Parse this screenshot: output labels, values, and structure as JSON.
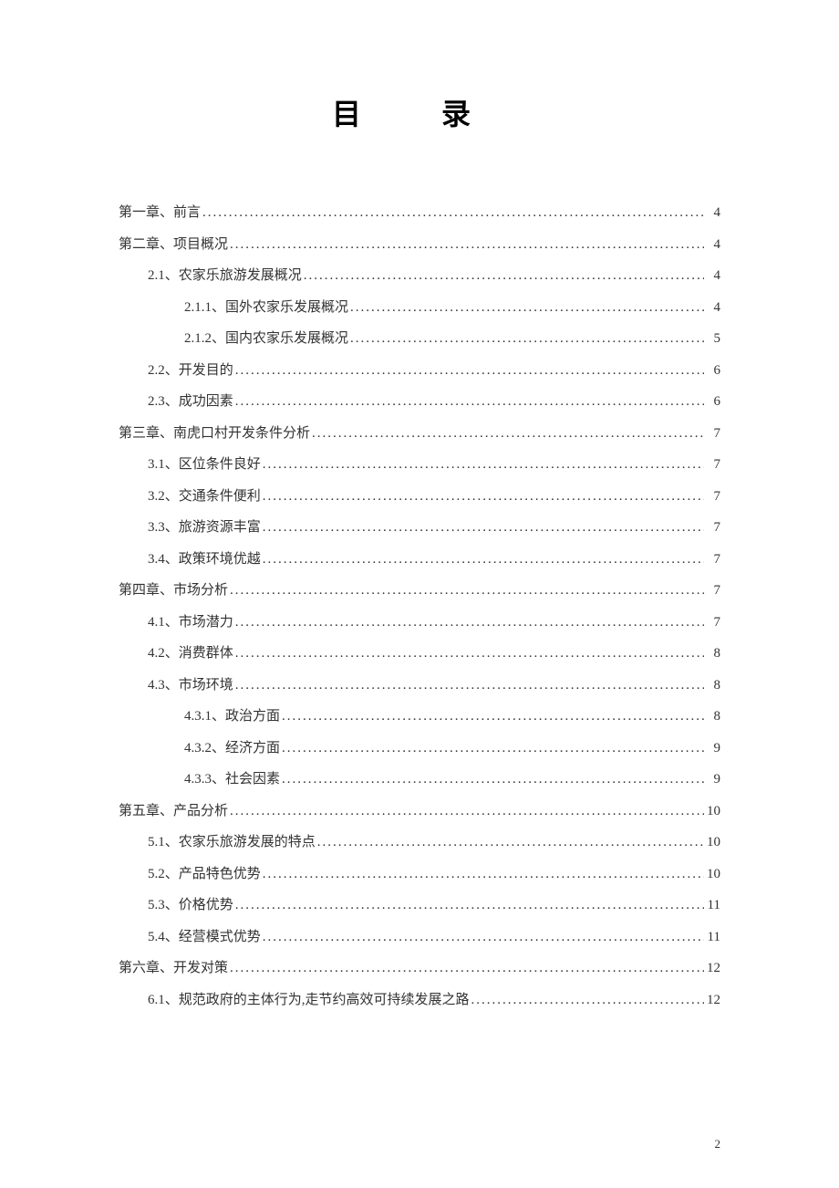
{
  "title": "目 录",
  "page_number": "2",
  "entries": [
    {
      "level": 0,
      "label": "第一章、前言",
      "page": "4"
    },
    {
      "level": 0,
      "label": "第二章、项目概况",
      "page": "4"
    },
    {
      "level": 1,
      "label": "2.1、农家乐旅游发展概况",
      "page": "4"
    },
    {
      "level": 2,
      "label": "2.1.1、国外农家乐发展概况",
      "page": "4"
    },
    {
      "level": 2,
      "label": "2.1.2、国内农家乐发展概况",
      "page": "5"
    },
    {
      "level": 1,
      "label": "2.2、开发目的",
      "page": "6"
    },
    {
      "level": 1,
      "label": "2.3、成功因素",
      "page": "6"
    },
    {
      "level": 0,
      "label": "第三章、南虎口村开发条件分析",
      "page": "7"
    },
    {
      "level": 1,
      "label": "3.1、区位条件良好",
      "page": "7"
    },
    {
      "level": 1,
      "label": "3.2、交通条件便利",
      "page": "7"
    },
    {
      "level": 1,
      "label": "3.3、旅游资源丰富",
      "page": "7"
    },
    {
      "level": 1,
      "label": "3.4、政策环境优越",
      "page": "7"
    },
    {
      "level": 0,
      "label": "第四章、市场分析",
      "page": "7"
    },
    {
      "level": 1,
      "label": "4.1、市场潜力",
      "page": "7"
    },
    {
      "level": 1,
      "label": "4.2、消费群体",
      "page": "8"
    },
    {
      "level": 1,
      "label": "4.3、市场环境",
      "page": "8"
    },
    {
      "level": 2,
      "label": "4.3.1、政治方面",
      "page": "8"
    },
    {
      "level": 2,
      "label": "4.3.2、经济方面",
      "page": "9"
    },
    {
      "level": 2,
      "label": "4.3.3、社会因素",
      "page": "9"
    },
    {
      "level": 0,
      "label": "第五章、产品分析",
      "page": "10"
    },
    {
      "level": 1,
      "label": "5.1、农家乐旅游发展的特点",
      "page": "10"
    },
    {
      "level": 1,
      "label": "5.2、产品特色优势",
      "page": "10"
    },
    {
      "level": 1,
      "label": "5.3、价格优势",
      "page": "11"
    },
    {
      "level": 1,
      "label": "5.4、经营模式优势",
      "page": "11"
    },
    {
      "level": 0,
      "label": "第六章、开发对策",
      "page": "12"
    },
    {
      "level": 1,
      "label": "6.1、规范政府的主体行为,走节约高效可持续发展之路",
      "page": "12"
    }
  ]
}
